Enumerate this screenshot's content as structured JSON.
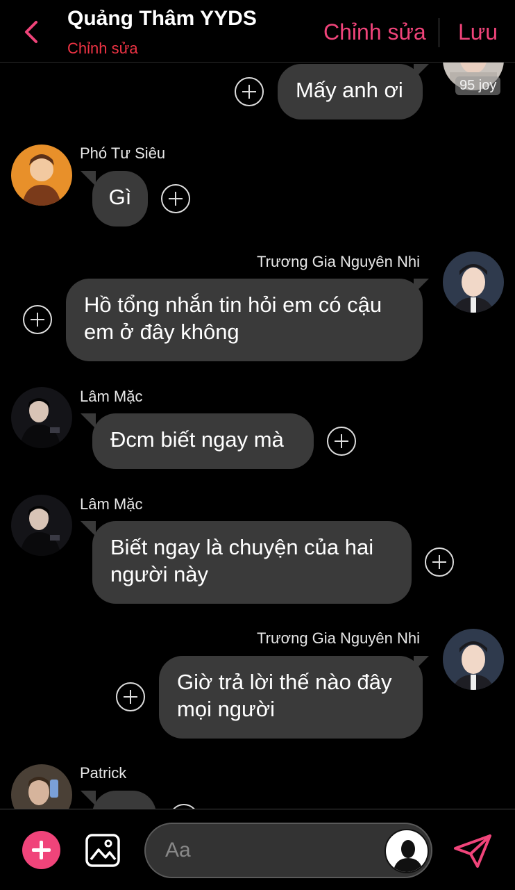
{
  "header": {
    "title": "Quảng Thâm YYDS",
    "subtitle": "Chỉnh sửa",
    "edit_label": "Chỉnh sửa",
    "save_label": "Lưu",
    "accent_color": "#f0447a"
  },
  "messages": [
    {
      "side": "right",
      "sender": "",
      "text": "Mấy anh ơi",
      "badge": "95 joy"
    },
    {
      "side": "left",
      "sender": "Phó Tư Siêu",
      "text": "Gì"
    },
    {
      "side": "right",
      "sender": "Trương Gia Nguyên Nhi",
      "text": "Hồ tổng nhắn tin hỏi em có cậu em ở đây không"
    },
    {
      "side": "left",
      "sender": "Lâm Mặc",
      "text": "Đcm biết ngay mà"
    },
    {
      "side": "left",
      "sender": "Lâm Mặc",
      "text": "Biết ngay là chuyện của hai người này"
    },
    {
      "side": "right",
      "sender": "Trương Gia Nguyên Nhi",
      "text": "Giờ trả lời thế nào đây mọi người"
    },
    {
      "side": "left",
      "sender": "Patrick",
      "text": ""
    }
  ],
  "composer": {
    "placeholder": "Aa",
    "icons": [
      "plus-icon",
      "image-icon",
      "profile-icon",
      "send-icon"
    ]
  }
}
